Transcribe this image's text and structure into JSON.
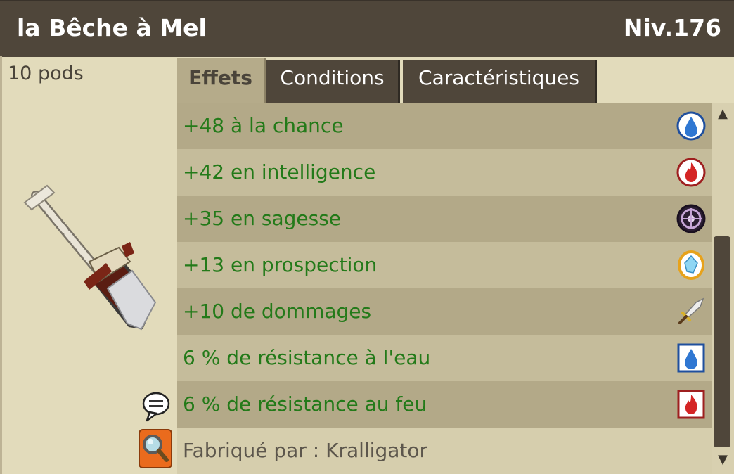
{
  "item": {
    "name": "la Bêche à Mel",
    "level": "Niv.176",
    "weight": "10 pods"
  },
  "tabs": [
    {
      "label": "Effets",
      "active": true
    },
    {
      "label": "Conditions",
      "active": false
    },
    {
      "label": "Caractéristiques",
      "active": false
    }
  ],
  "effects": [
    {
      "text": "+48 à la chance",
      "icon": "water-drop-icon"
    },
    {
      "text": "+42 en intelligence",
      "icon": "fire-icon"
    },
    {
      "text": "+35 en sagesse",
      "icon": "wisdom-icon"
    },
    {
      "text": "+13 en prospection",
      "icon": "prospecting-icon"
    },
    {
      "text": "+10 de dommages",
      "icon": "sword-icon"
    },
    {
      "text": "6 % de résistance à l'eau",
      "icon": "water-resistance-icon"
    },
    {
      "text": "6 % de résistance au feu",
      "icon": "fire-resistance-icon"
    }
  ],
  "crafted_by": "Fabriqué par : Kralligator",
  "colors": {
    "titlebar": "#4f463a",
    "effect_text": "#237a19",
    "panel_bg": "#e2dbbb"
  }
}
